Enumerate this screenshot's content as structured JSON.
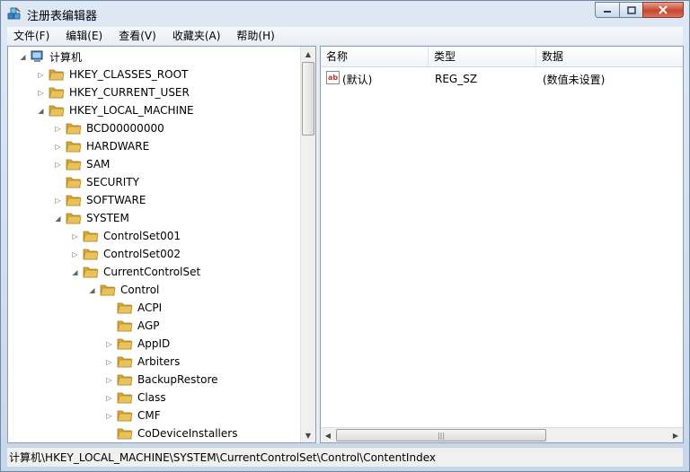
{
  "window": {
    "title": "注册表编辑器"
  },
  "menu": {
    "items": [
      {
        "label": "文件(F)"
      },
      {
        "label": "编辑(E)"
      },
      {
        "label": "查看(V)"
      },
      {
        "label": "收藏夹(A)"
      },
      {
        "label": "帮助(H)"
      }
    ]
  },
  "tree": {
    "root": "计算机",
    "nodes": [
      {
        "label": "HKEY_CLASSES_ROOT",
        "depth": 1,
        "state": "collapsed"
      },
      {
        "label": "HKEY_CURRENT_USER",
        "depth": 1,
        "state": "collapsed"
      },
      {
        "label": "HKEY_LOCAL_MACHINE",
        "depth": 1,
        "state": "expanded"
      },
      {
        "label": "BCD00000000",
        "depth": 2,
        "state": "collapsed"
      },
      {
        "label": "HARDWARE",
        "depth": 2,
        "state": "collapsed"
      },
      {
        "label": "SAM",
        "depth": 2,
        "state": "collapsed"
      },
      {
        "label": "SECURITY",
        "depth": 2,
        "state": "leaf"
      },
      {
        "label": "SOFTWARE",
        "depth": 2,
        "state": "collapsed"
      },
      {
        "label": "SYSTEM",
        "depth": 2,
        "state": "expanded"
      },
      {
        "label": "ControlSet001",
        "depth": 3,
        "state": "collapsed"
      },
      {
        "label": "ControlSet002",
        "depth": 3,
        "state": "collapsed"
      },
      {
        "label": "CurrentControlSet",
        "depth": 3,
        "state": "expanded"
      },
      {
        "label": "Control",
        "depth": 4,
        "state": "expanded"
      },
      {
        "label": "ACPI",
        "depth": 5,
        "state": "leaf"
      },
      {
        "label": "AGP",
        "depth": 5,
        "state": "leaf"
      },
      {
        "label": "AppID",
        "depth": 5,
        "state": "collapsed"
      },
      {
        "label": "Arbiters",
        "depth": 5,
        "state": "collapsed"
      },
      {
        "label": "BackupRestore",
        "depth": 5,
        "state": "collapsed"
      },
      {
        "label": "Class",
        "depth": 5,
        "state": "collapsed"
      },
      {
        "label": "CMF",
        "depth": 5,
        "state": "collapsed"
      },
      {
        "label": "CoDeviceInstallers",
        "depth": 5,
        "state": "leaf"
      }
    ]
  },
  "list": {
    "columns": [
      {
        "label": "名称"
      },
      {
        "label": "类型"
      },
      {
        "label": "数据"
      }
    ],
    "rows": [
      {
        "name": "(默认)",
        "type": "REG_SZ",
        "data": "(数值未设置)"
      }
    ]
  },
  "status": {
    "path": "计算机\\HKEY_LOCAL_MACHINE\\SYSTEM\\CurrentControlSet\\Control\\ContentIndex"
  },
  "colors": {
    "folder": "#e8c25a",
    "accent": "#3c7fb1"
  }
}
